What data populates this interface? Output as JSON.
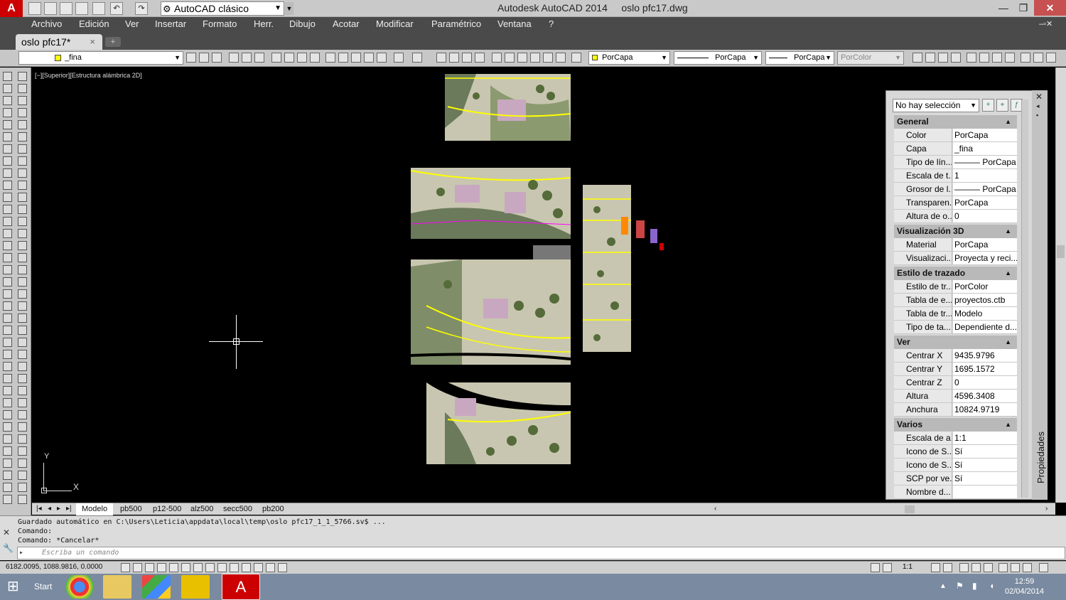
{
  "titlebar": {
    "workspace": "AutoCAD clásico",
    "title": "Autodesk AutoCAD 2014     oslo pfc17.dwg"
  },
  "menu": [
    "Archivo",
    "Edición",
    "Ver",
    "Insertar",
    "Formato",
    "Herr.",
    "Dibujo",
    "Acotar",
    "Modificar",
    "Paramétrico",
    "Ventana",
    "?"
  ],
  "doc_tab": {
    "label": "oslo pfc17*",
    "close": "×"
  },
  "toolbar": {
    "layer": "_fina",
    "color": "PorCapa",
    "linetype": "PorCapa",
    "lineweight": "PorCapa",
    "plotstyle": "PorColor"
  },
  "viewport": {
    "label": "[−][Superior][Estructura alámbrica 2D]",
    "axis_y": "Y",
    "axis_x": "X"
  },
  "properties": {
    "selection": "No hay selección",
    "vertical_title": "Propiedades",
    "sections": [
      {
        "title": "General",
        "rows": [
          {
            "k": "Color",
            "v": "PorCapa"
          },
          {
            "k": "Capa",
            "v": "_fina"
          },
          {
            "k": "Tipo de lín...",
            "v": "——— PorCapa"
          },
          {
            "k": "Escala de t...",
            "v": "1"
          },
          {
            "k": "Grosor de l...",
            "v": "——— PorCapa"
          },
          {
            "k": "Transparen...",
            "v": "PorCapa"
          },
          {
            "k": "Altura de o...",
            "v": "0"
          }
        ]
      },
      {
        "title": "Visualización 3D",
        "rows": [
          {
            "k": "Material",
            "v": "PorCapa"
          },
          {
            "k": "Visualizaci...",
            "v": "Proyecta y reci..."
          }
        ]
      },
      {
        "title": "Estilo de trazado",
        "rows": [
          {
            "k": "Estilo de tr...",
            "v": "PorColor"
          },
          {
            "k": "Tabla de e...",
            "v": "proyectos.ctb"
          },
          {
            "k": "Tabla de tr...",
            "v": "Modelo"
          },
          {
            "k": "Tipo de ta...",
            "v": "Dependiente d..."
          }
        ]
      },
      {
        "title": "Ver",
        "rows": [
          {
            "k": "Centrar X",
            "v": "9435.9796"
          },
          {
            "k": "Centrar Y",
            "v": "1695.1572"
          },
          {
            "k": "Centrar Z",
            "v": "0"
          },
          {
            "k": "Altura",
            "v": "4596.3408"
          },
          {
            "k": "Anchura",
            "v": "10824.9719"
          }
        ]
      },
      {
        "title": "Varios",
        "rows": [
          {
            "k": "Escala de a...",
            "v": "1:1"
          },
          {
            "k": "Icono de S...",
            "v": "Sí"
          },
          {
            "k": "Icono de S...",
            "v": "Sí"
          },
          {
            "k": "SCP por ve...",
            "v": "Sí"
          },
          {
            "k": "Nombre d...",
            "v": ""
          }
        ]
      }
    ]
  },
  "layout_tabs": [
    "Modelo",
    "pb500",
    "p12-500",
    "alz500",
    "secc500",
    "pb200"
  ],
  "command": {
    "lines": [
      "Guardado automático en C:\\Users\\Leticia\\appdata\\local\\temp\\oslo pfc17_1_1_5766.sv$ ...",
      "Comando:",
      "Comando: *Cancelar*"
    ],
    "placeholder": "Escriba un comando",
    "prompt": "▸"
  },
  "status": {
    "coords": "6182.0095, 1088.9816, 0.0000",
    "scale": "1:1"
  },
  "taskbar": {
    "start": "Start",
    "time": "12:59",
    "date": "02/04/2014"
  }
}
